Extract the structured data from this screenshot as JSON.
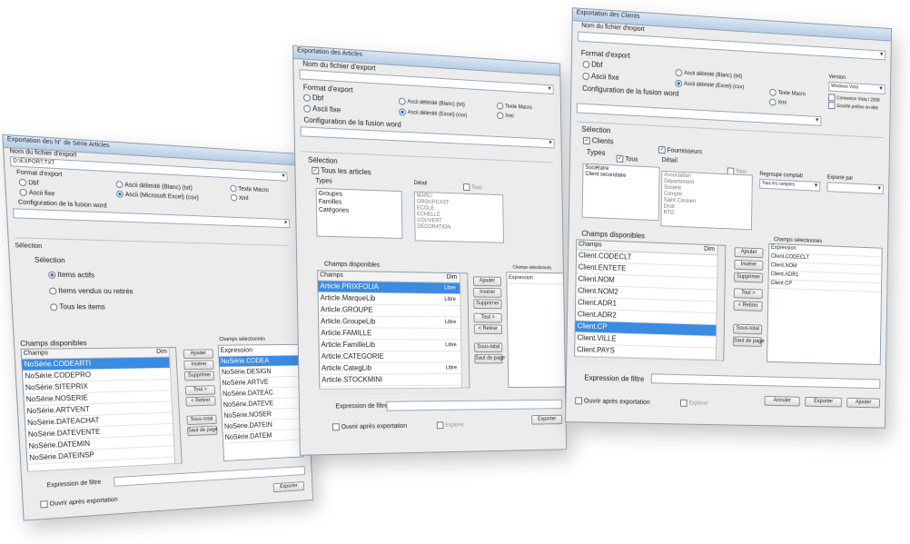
{
  "w1": {
    "title": "Exportation des N° de Série Articles",
    "filename_label": "Nom du fichier d'export",
    "filename_value": "D:\\EXPORT.TXT",
    "format_label": "Format d'export",
    "formats": [
      "Dbf",
      "Ascii fixe"
    ],
    "excel_options": [
      "Ascii délimité (Blanc) (txt)",
      "Ascii (Microsoft Excel) (csv)"
    ],
    "extra_formats": [
      "Texte Macro",
      "Xml"
    ],
    "word_label": "Configuration de la fusion word",
    "selection_label": "Sélection",
    "selection_sub": "Sélection",
    "radios": [
      "Items actifs",
      "Items vendus ou retirés",
      "Tous les items"
    ],
    "champs_label": "Champs disponibles",
    "list_header": "Champs",
    "list_header2": "Dim",
    "fields": [
      "NoSérie.CODEARTI",
      "NoSérie.CODEPRO",
      "NoSérie.SITEPRIX",
      "NoSérie.NOSERIE",
      "NoSérie.ARTVENT",
      "NoSérie.DATEACHAT",
      "NoSérie.DATEVENTE",
      "NoSérie.DATEMIN",
      "NoSérie.DATEINSP"
    ],
    "buttons": [
      "Ajouter",
      "Insérer",
      "Supprimer",
      "Tout >",
      "< Retirer"
    ],
    "buttons2": [
      "Sous-total",
      "Saut de page"
    ],
    "right_header": "Champs sélectionnés",
    "right_list": [
      "Expression",
      "NoSérie.CODEA",
      "NoSérie.DESIGN",
      "NoSérie.ARTVE",
      "NoSérie.DATEAC",
      "NoSérie.DATEVE",
      "NoSérie.NOSER",
      "NoSérie.DATEIN",
      "NoSérie.DATEM"
    ],
    "filter_label": "Expression de filtre",
    "open_after": "Ouvrir après exportation",
    "exporter": "Exporter"
  },
  "w2": {
    "title": "Exportation des Articles",
    "filename_label": "Nom du fichier d'export",
    "format_label": "Format d'export",
    "formats": [
      "Dbf",
      "Ascii fixe"
    ],
    "excel_options": [
      "Ascii délimité (Blanc) (txt)",
      "Ascii délimité (Excel) (csv)"
    ],
    "extra_formats": [
      "Texte Macro",
      "Xml"
    ],
    "word_label": "Configuration de la fusion word",
    "selection_label": "Sélection",
    "all_articles": "Tous les articles",
    "types_label": "Types",
    "types": [
      "Groupes",
      "Familles",
      "Catégories"
    ],
    "detail_label": "Détail",
    "tous": "Tous",
    "details": [
      "MARLI",
      "GROUPCAST",
      "ECOLE",
      "ECHELLE",
      "COUVERT",
      "DECORATION"
    ],
    "champs_label": "Champs disponibles",
    "list_header": "Champs",
    "list_header2": "Dim",
    "fields": [
      "Article.PRIXFOLIA",
      "Article.MarqueLib",
      "Article.GROUPE",
      "Article.GroupeLib",
      "Article.FAMILLE",
      "Article.FamilleLib",
      "Article.CATEGORIE",
      "Article.CategLib",
      "Article.STOCKMINI"
    ],
    "field_types": [
      "Libre",
      "Libre",
      "",
      "Libre",
      "",
      "Libre",
      "",
      "Libre",
      ""
    ],
    "buttons": [
      "Ajouter",
      "Insérer",
      "Supprimer",
      "Tout >",
      "< Retirer"
    ],
    "buttons2": [
      "Sous-total",
      "Saut de page"
    ],
    "right_header": "Champs sélectionnés",
    "right_list": [
      "Expression"
    ],
    "filter_label": "Expression de filtre",
    "open_after": "Ouvrir après exportation",
    "explorer": "Explorer",
    "exporter": "Exporter"
  },
  "w3": {
    "title": "Exportation des Clients",
    "filename_label": "Nom du fichier d'export",
    "format_label": "Format d'export",
    "formats": [
      "Dbf",
      "Ascii fixe"
    ],
    "excel_options": [
      "Ascii délimité (Blanc) (txt)",
      "Ascii délimité (Excel) (csv)"
    ],
    "extra_formats": [
      "Texte Macro",
      "Xml"
    ],
    "word_label": "Configuration de la fusion word",
    "version_label": "Version",
    "version_value": "Windows Vista",
    "version_opts": [
      "Connexion Vista / 2008",
      "Société préfixe en-tête"
    ],
    "selection_label": "Sélection",
    "clients": "Clients",
    "fournisseurs": "Fournisseurs",
    "types_label": "Types",
    "tous": "Tous",
    "detail_label": "Détail",
    "types": [
      "Sociétaire",
      "Client secondaire"
    ],
    "details": [
      "Association",
      "Département",
      "Société",
      "Compte",
      "Saint Cassien",
      "Droit",
      "RTG"
    ],
    "lieu_label": "Regroupé comptab",
    "lieu_value": "Tous les comptes",
    "export_par": "Exporté par",
    "champs_label": "Champs disponibles",
    "list_header": "Champs",
    "list_header2": "Dim",
    "fields": [
      "Client.CODECLT",
      "Client.ENTETE",
      "Client.NOM",
      "Client.NOM2",
      "Client.ADR1",
      "Client.ADR2",
      "Client.CP",
      "Client.VILLE",
      "Client.PAYS"
    ],
    "buttons": [
      "Ajouter",
      "Insérer",
      "Supprimer",
      "Tout >",
      "< Retirer"
    ],
    "buttons2": [
      "Sous-total",
      "Saut de page"
    ],
    "right_header": "Champs sélectionnés",
    "right_list": [
      "Expression",
      "Client.CODECLT",
      "Client.NOM",
      "Client.ADR1",
      "Client.CP"
    ],
    "filter_label": "Expression de filtre",
    "open_after": "Ouvrir après exportation",
    "explorer": "Explorer",
    "actions": [
      "Annuler",
      "Exporter",
      "Ajouter"
    ]
  }
}
